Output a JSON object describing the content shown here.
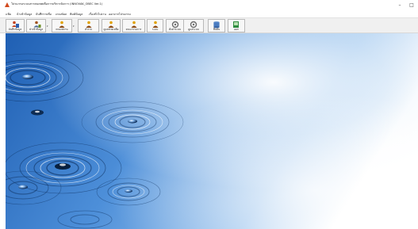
{
  "window": {
    "title": "โปรแกรมระบบสารสนเทศเพื่อการบริหารจัดการ (INNOVAK_OBEC Ver.1)",
    "minimize_glyph": "–",
    "maximize_glyph": "□"
  },
  "menu": [
    {
      "label": "แฟ้ม"
    },
    {
      "label": "นำเข้าข้อมูล"
    },
    {
      "label": "บันทึกรายชื่อ"
    },
    {
      "label": "เกณฑ์ผล"
    },
    {
      "label": "พิมพ์ข้อมูล"
    },
    {
      "label": "เรื่องทั่วไปงาน"
    },
    {
      "label": "ออกจากโปรแกรม"
    }
  ],
  "toolbar": [
    {
      "label": "บันทึกข้อมูล",
      "icon": "person-book-icon"
    },
    {
      "label": "นำเข้าข้อมูล",
      "icon": "import-person-icon"
    },
    {
      "label": "ครองสถาน",
      "icon": "teacher-icon"
    },
    {
      "label": "สำรวจ",
      "icon": "teacher-survey-icon"
    },
    {
      "label": "ดูแลช่วยเหลือ",
      "icon": "teacher-help-icon"
    },
    {
      "label": "คณะกรรมการ",
      "icon": "teacher-committee-icon"
    },
    {
      "label": "ระบบ",
      "icon": "teacher-system-icon"
    },
    {
      "label": "ตั้งค่าระบบ",
      "icon": "settings-icon"
    },
    {
      "label": "ดูแลระบบ",
      "icon": "settings-admin-icon"
    },
    {
      "label": "สืบค้น",
      "icon": "database-icon"
    },
    {
      "label": "ออก",
      "icon": "exit-icon"
    }
  ],
  "colors": {
    "accent_red": "#c2401f",
    "sky_blue": "#2c6fc0",
    "ripple_dark": "#0d2f5e"
  }
}
